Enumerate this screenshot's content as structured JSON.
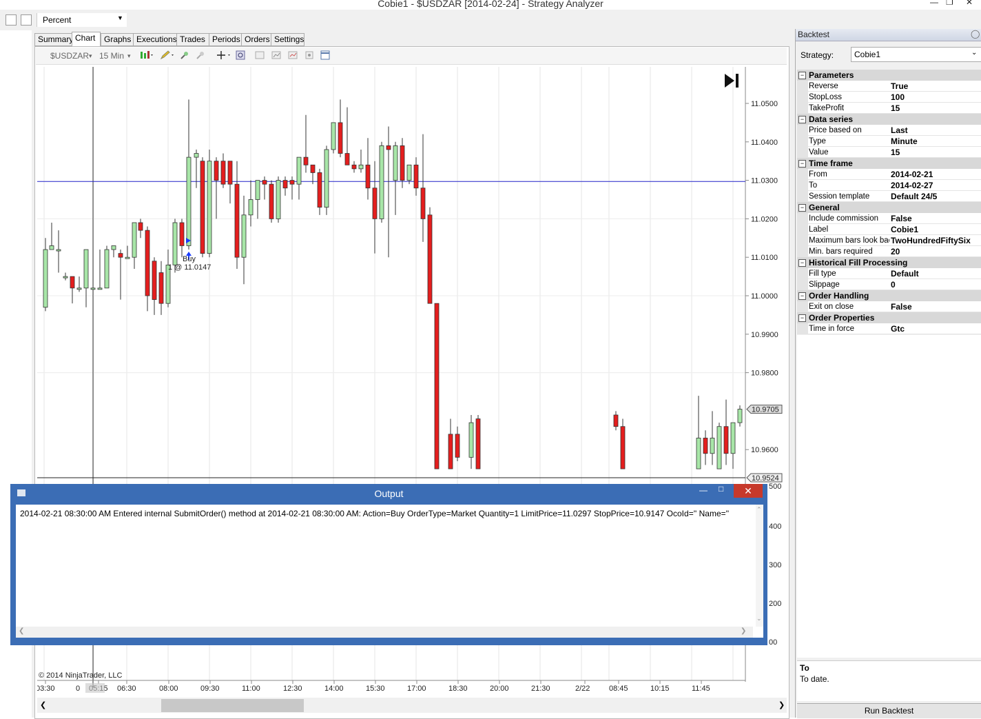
{
  "window": {
    "title": "Cobie1 - $USDZAR [2014-02-24] - Strategy Analyzer"
  },
  "top_toolbar": {
    "display_mode": "Percent"
  },
  "tabs": [
    {
      "label": "Summary"
    },
    {
      "label": "Chart"
    },
    {
      "label": "Graphs"
    },
    {
      "label": "Executions"
    },
    {
      "label": "Trades"
    },
    {
      "label": "Periods"
    },
    {
      "label": "Orders"
    },
    {
      "label": "Settings"
    }
  ],
  "chart_toolbar": {
    "instrument": "$USDZAR",
    "interval": "15 Min"
  },
  "chart": {
    "copyright": "© 2014 NinjaTrader, LLC",
    "y_ticks": [
      "11.0500",
      "11.0400",
      "11.0300",
      "11.0200",
      "11.0100",
      "11.0000",
      "10.9900",
      "10.9800",
      "10.9600"
    ],
    "y_ticks_partial": [
      "500",
      "400",
      "300",
      "200",
      "00"
    ],
    "x_ticks": [
      "03:30",
      "05:15",
      "06:30",
      "08:00",
      "09:30",
      "11:00",
      "12:30",
      "14:00",
      "15:30",
      "17:00",
      "18:30",
      "20:00",
      "21:30",
      "2/22",
      "08:45",
      "10:15",
      "11:45"
    ],
    "x_tick_extra": "0",
    "price_markers": [
      "10.9705",
      "10.9524"
    ],
    "execution": {
      "label": "Buy",
      "detail": "1 @ 11.0147"
    },
    "colors": {
      "up": "#a8e6a8",
      "down": "#e41e1e",
      "hline": "#2020c8"
    }
  },
  "output_window": {
    "title": "Output",
    "text": "2014-02-21 08:30:00 AM Entered internal SubmitOrder() method at 2014-02-21 08:30:00 AM: Action=Buy OrderType=Market Quantity=1 LimitPrice=11.0297 StopPrice=10.9147 OcoId='' Name=''"
  },
  "backtest_panel": {
    "header": "Backtest",
    "strategy_label": "Strategy:",
    "strategy_value": "Cobie1",
    "categories": [
      {
        "name": "Parameters",
        "props": [
          [
            "Reverse",
            "True"
          ],
          [
            "StopLoss",
            "100"
          ],
          [
            "TakeProfit",
            "15"
          ]
        ]
      },
      {
        "name": "Data series",
        "props": [
          [
            "Price based on",
            "Last"
          ],
          [
            "Type",
            "Minute"
          ],
          [
            "Value",
            "15"
          ]
        ]
      },
      {
        "name": "Time frame",
        "props": [
          [
            "From",
            "2014-02-21"
          ],
          [
            "To",
            "2014-02-27"
          ],
          [
            "Session template",
            "Default 24/5"
          ]
        ]
      },
      {
        "name": "General",
        "props": [
          [
            "Include commission",
            "False"
          ],
          [
            "Label",
            "Cobie1"
          ],
          [
            "Maximum bars look bac",
            "TwoHundredFiftySix"
          ],
          [
            "Min. bars required",
            "20"
          ]
        ]
      },
      {
        "name": "Historical Fill Processing",
        "props": [
          [
            "Fill type",
            "Default"
          ],
          [
            "Slippage",
            "0"
          ]
        ]
      },
      {
        "name": "Order Handling",
        "props": [
          [
            "Exit on close",
            "False"
          ]
        ]
      },
      {
        "name": "Order Properties",
        "props": [
          [
            "Time in force",
            "Gtc"
          ]
        ]
      }
    ],
    "description_title": "To",
    "description_text": "To date.",
    "run_button": "Run Backtest"
  }
}
